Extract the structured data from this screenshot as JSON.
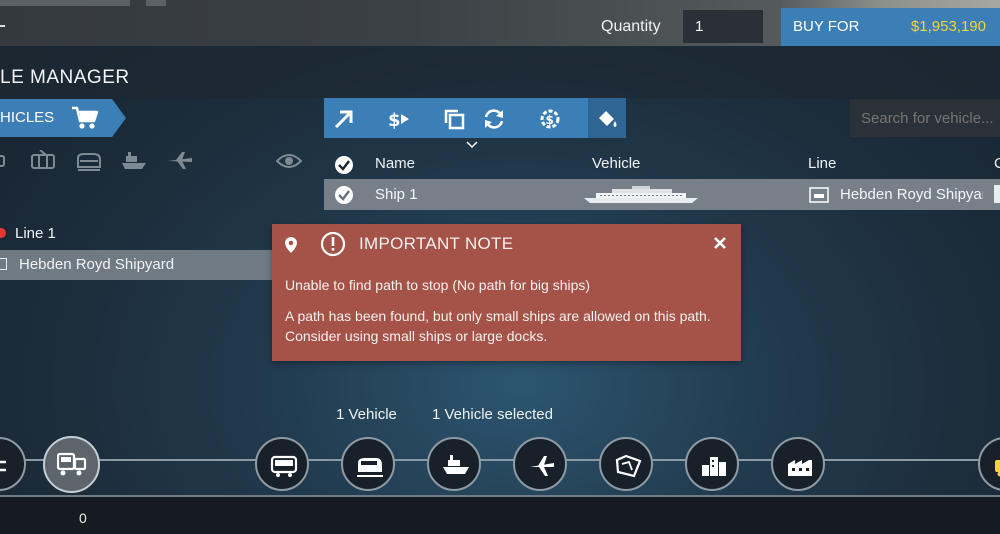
{
  "top_bar": {
    "quantity_label": "Quantity",
    "quantity_value": "1",
    "buy_label": "BUY FOR",
    "buy_price": "$1,953,190"
  },
  "title": "LE MANAGER",
  "vehicles_tab": {
    "label": "HICLES"
  },
  "search": {
    "placeholder": "Search for vehicle..."
  },
  "table": {
    "headers": [
      "Name",
      "Vehicle",
      "Line",
      "C"
    ],
    "rows": [
      {
        "name": "Ship 1",
        "line": "Hebden Royd Shipyard"
      }
    ]
  },
  "left_list": {
    "line": "Line 1",
    "stop": "Hebden Royd Shipyard"
  },
  "notice": {
    "title": "IMPORTANT NOTE",
    "line1": "Unable to find path to stop (No path for big ships)",
    "line2": "A path has been found, but only small ships are allowed on this path. Consider using small ships or large docks."
  },
  "counts": {
    "vehicles": "1 Vehicle",
    "selected": "1 Vehicle selected"
  },
  "bottom": {
    "count": "0"
  },
  "colors": {
    "accent_blue": "#3c7fb6",
    "price_yellow": "#f4d43b",
    "notice_red": "#a55248",
    "line_red": "#e53636"
  }
}
